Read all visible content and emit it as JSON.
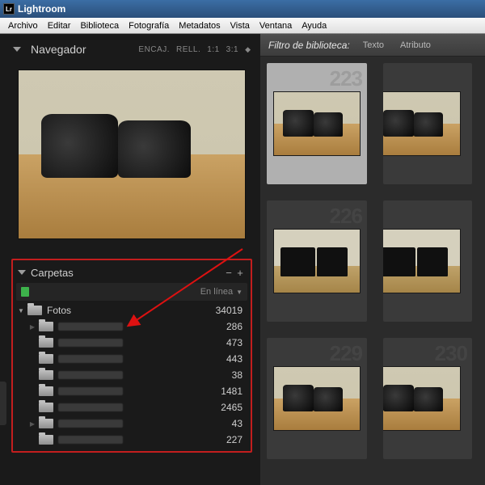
{
  "titlebar": {
    "icon_text": "Lr",
    "title": "Lightroom"
  },
  "menu": {
    "items": [
      "Archivo",
      "Editar",
      "Biblioteca",
      "Fotografía",
      "Metadatos",
      "Vista",
      "Ventana",
      "Ayuda"
    ]
  },
  "navigator": {
    "title": "Navegador",
    "ratios": [
      "ENCAJ.",
      "RELL.",
      "1:1",
      "3:1"
    ]
  },
  "folders": {
    "title": "Carpetas",
    "minus": "−",
    "plus": "+",
    "status": "En línea",
    "root": {
      "name": "Fotos",
      "count": "34019"
    },
    "children": [
      {
        "arrow": "closed",
        "count": "286"
      },
      {
        "arrow": "none",
        "count": "473"
      },
      {
        "arrow": "none",
        "count": "443"
      },
      {
        "arrow": "none",
        "count": "38"
      },
      {
        "arrow": "none",
        "count": "1481"
      },
      {
        "arrow": "none",
        "count": "2465"
      },
      {
        "arrow": "closed",
        "count": "43"
      },
      {
        "arrow": "none",
        "count": "227"
      }
    ]
  },
  "filter": {
    "label": "Filtro de biblioteca:",
    "buttons": [
      "Texto",
      "Atributo"
    ]
  },
  "grid": {
    "cells": [
      {
        "ghost": "223",
        "selected": true,
        "variant": "cam",
        "cut": false
      },
      {
        "ghost": "",
        "selected": false,
        "variant": "cam",
        "cut": true
      },
      {
        "ghost": "226",
        "selected": false,
        "variant": "camb",
        "cut": false
      },
      {
        "ghost": "",
        "selected": false,
        "variant": "camb",
        "cut": true
      },
      {
        "ghost": "229",
        "selected": false,
        "variant": "cam",
        "cut": false
      },
      {
        "ghost": "230",
        "selected": false,
        "variant": "cam",
        "cut": true
      }
    ]
  }
}
